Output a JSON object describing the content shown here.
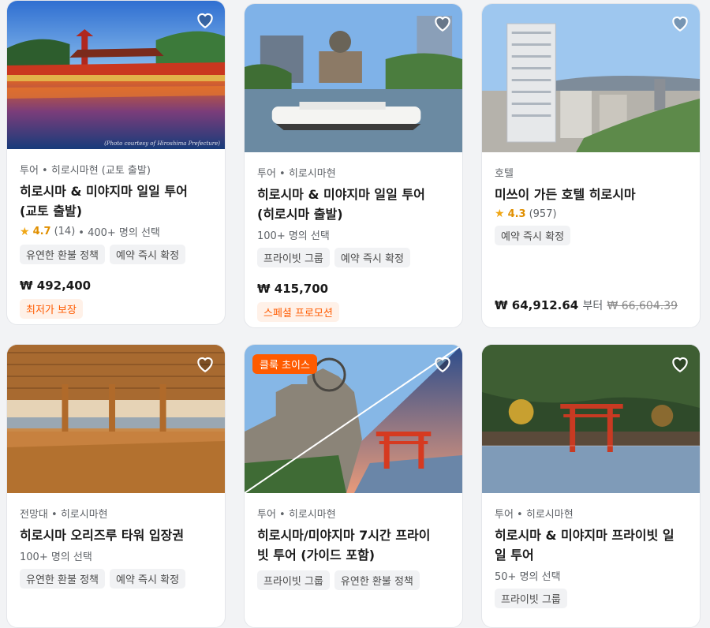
{
  "cards": [
    {
      "category": "투어 • 히로시마현 (교토 출발)",
      "title_line1": "히로시마 & 미야지마 일일 투어",
      "title_line2": "(교토 출발)",
      "rating": "4.7",
      "reviews": "(14)",
      "booked": "• 400+ 명의 선택",
      "tags": [
        "유연한 환불 정책",
        "예약 즉시 확정"
      ],
      "price": "₩ 492,400",
      "badge": "최저가 보장",
      "photo_caption": "(Photo courtesy of Hiroshima Prefecture)",
      "wishlist_icon": "heart-outline-icon"
    },
    {
      "category": "투어 • 히로시마현",
      "title_line1": "히로시마 & 미야지마 일일 투어",
      "title_line2": "(히로시마 출발)",
      "booked": "100+ 명의 선택",
      "tags": [
        "프라이빗 그룹",
        "예약 즉시 확정"
      ],
      "price": "₩ 415,700",
      "badge": "스페셜 프로모션",
      "wishlist_icon": "heart-outline-icon"
    },
    {
      "category": "호텔",
      "title_line1": "미쓰이 가든 호텔 히로시마",
      "rating": "4.3",
      "reviews": "(957)",
      "tags": [
        "예약 즉시 확정"
      ],
      "price": "₩ 64,912.64",
      "price_unit": "부터",
      "price_old": "₩ 66,604.39",
      "wishlist_icon": "heart-outline-icon"
    },
    {
      "category": "전망대 • 히로시마현",
      "title_line1": "히로시마 오리즈루 타워 입장권",
      "booked": "100+ 명의 선택",
      "tags": [
        "유연한 환불 정책",
        "예약 즉시 확정"
      ],
      "wishlist_icon": "heart-outline-icon"
    },
    {
      "choice_badge": "클룩 초이스",
      "category": "투어 • 히로시마현",
      "title_line1": "히로시마/미야지마 7시간 프라이",
      "title_line2": "빗 투어 (가이드 포함)",
      "tags": [
        "프라이빗 그룹",
        "유연한 환불 정책"
      ],
      "wishlist_icon": "heart-outline-icon"
    },
    {
      "category": "투어 • 히로시마현",
      "title_line1": "히로시마 & 미야지마 프라이빗 일",
      "title_line2": "일 투어",
      "booked": "50+ 명의 선택",
      "tags": [
        "프라이빗 그룹"
      ],
      "wishlist_icon": "heart-outline-icon"
    }
  ],
  "colors": {
    "accent": "#ff5b00",
    "star": "#f0a716",
    "tag_bg": "#f1f2f4"
  }
}
